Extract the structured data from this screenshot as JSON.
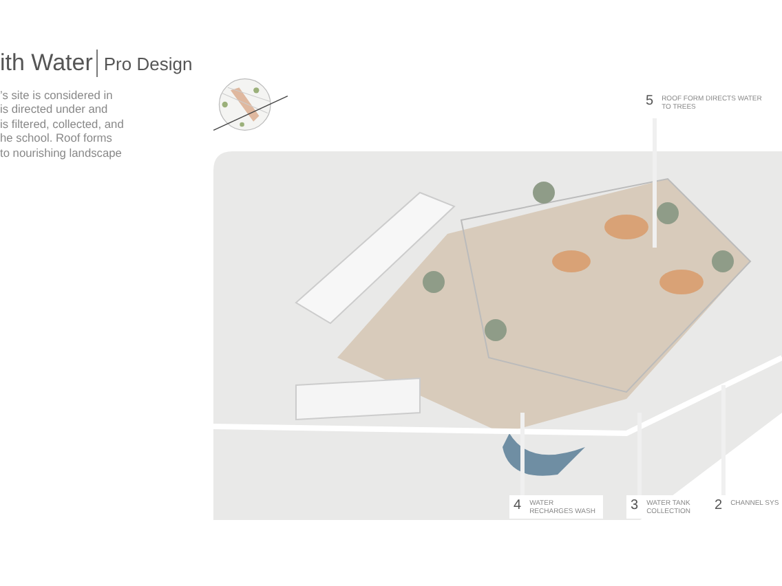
{
  "title": {
    "main": "ith Water",
    "sub": "Pro Design"
  },
  "description": [
    "’s site is considered in",
    "is directed under and",
    "is filtered, collected, and",
    "he school. Roof forms",
    "to nourishing landscape"
  ],
  "callouts": [
    {
      "number": "5",
      "label": "ROOF FORM DIRECTS WATER TO TREES"
    },
    {
      "number": "4",
      "label": "WATER RECHARGES WASH"
    },
    {
      "number": "3",
      "label": "WATER TANK COLLECTION"
    },
    {
      "number": "2",
      "label": "CHANNEL SYS"
    }
  ]
}
